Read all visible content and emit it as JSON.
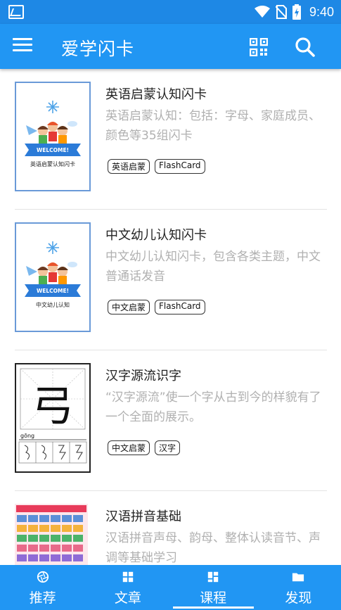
{
  "status": {
    "time": "9:40"
  },
  "appbar": {
    "title": "爱学闪卡"
  },
  "cards": [
    {
      "title": "英语启蒙认知闪卡",
      "desc": "英语启蒙认知：包括：字母、家庭成员、颜色等35组闪卡",
      "tags": [
        "英语启蒙",
        "FlashCard"
      ],
      "thumb_caption": "英语启蒙认知闪卡",
      "banner": "WELCOME!"
    },
    {
      "title": "中文幼儿认知闪卡",
      "desc": "中文幼儿认知闪卡，包含各类主题，中文普通话发音",
      "tags": [
        "中文启蒙",
        "FlashCard"
      ],
      "thumb_caption": "中文幼儿认知",
      "banner": "WELCOME!"
    },
    {
      "title": "汉字源流识字",
      "desc": "“汉字源流”使一个字从古到今的样貌有了一个全面的展示。",
      "tags": [
        "中文启蒙",
        "汉字"
      ],
      "thumb_char": "弓",
      "thumb_pinyin": "gōng"
    },
    {
      "title": "汉语拼音基础",
      "desc": "汉语拼音声母、韵母、整体认读音节、声调等基础学习",
      "tags": []
    }
  ],
  "nav": [
    {
      "label": "推荐",
      "icon": "camera-aperture-icon",
      "active": false
    },
    {
      "label": "文章",
      "icon": "grid-icon",
      "active": false
    },
    {
      "label": "课程",
      "icon": "dashboard-icon",
      "active": true
    },
    {
      "label": "发现",
      "icon": "folder-icon",
      "active": false
    }
  ],
  "colors": {
    "primary": "#2196f3",
    "statusbar": "#1e88e5",
    "desc": "#b0b0b0"
  }
}
